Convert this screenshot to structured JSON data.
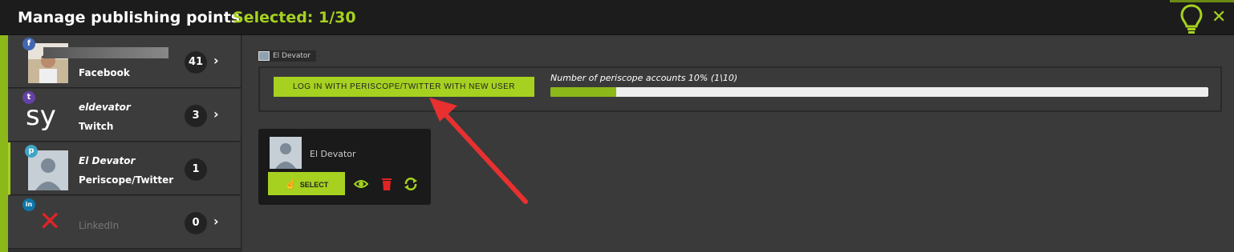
{
  "header": {
    "title": "Manage publishing points",
    "selected": "Selected: 1/30",
    "close_icon": "close-icon",
    "help_icon": "lightbulb-icon"
  },
  "colors": {
    "accent": "#a6d120",
    "header_bg": "#1c1c1c",
    "panel_bg": "#3a3a3a"
  },
  "sidebar": {
    "items": [
      {
        "name": "",
        "platform": "Facebook",
        "count": "41",
        "badge": "f",
        "badge_color": "#4267b2"
      },
      {
        "name": "eldevator",
        "platform": "Twitch",
        "count": "3",
        "badge": "t",
        "badge_color": "#6441a5"
      },
      {
        "name": "El Devator",
        "platform": "Periscope/Twitter",
        "count": "1",
        "badge": "p",
        "badge_color": "#40a4c4"
      },
      {
        "name": "",
        "platform": "LinkedIn",
        "count": "0",
        "badge": "in",
        "badge_color": "#0e76a8"
      }
    ]
  },
  "main": {
    "account_label": "El Devator",
    "login_button": "LOG IN WITH PERISCOPE/TWITTER WITH NEW USER",
    "accounts_text": "Number of periscope accounts 10% (1\\10)",
    "progress_percent": 10
  },
  "card": {
    "name": "El Devator",
    "select_label": "SELECT"
  }
}
